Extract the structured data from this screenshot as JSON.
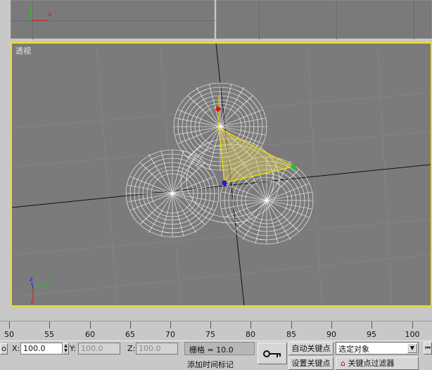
{
  "viewport": {
    "perspective_label": "透视"
  },
  "ruler": {
    "labels": [
      "50",
      "55",
      "60",
      "65",
      "70",
      "75",
      "80",
      "85",
      "90",
      "95",
      "100"
    ]
  },
  "status": {
    "x_label": "X:",
    "x_value": "100.0",
    "y_label": "Y:",
    "y_value": "100.0",
    "z_label": "Z:",
    "z_value": "100.0",
    "grid_text": "栅格 = 10.0",
    "auto_key_label": "自动关键点",
    "set_key_label": "设置关键点",
    "selection_value": "选定对象",
    "key_filter_label": "关键点过滤器",
    "add_time_tag_label": "添加时间标记"
  },
  "colors": {
    "viewport_border": "#f2e000",
    "wire": "#ffffff",
    "axis_x": "#e81010",
    "axis_y": "#18c818",
    "axis_z": "#1818e8"
  },
  "icons": [
    "key-icon",
    "lock-icon",
    "goto-start-icon",
    "chevron-down-icon"
  ]
}
